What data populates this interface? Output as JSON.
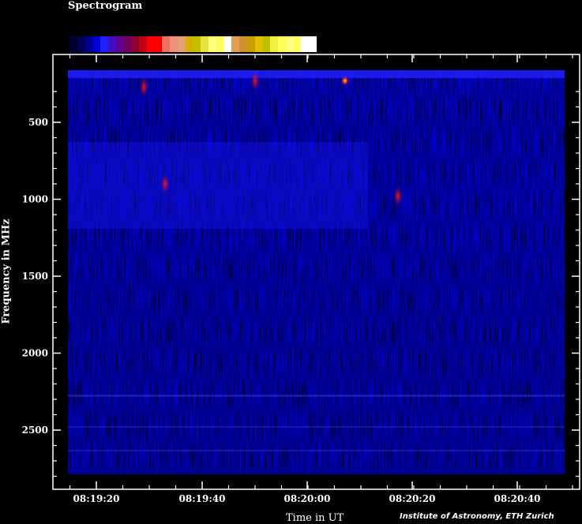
{
  "chart_data": {
    "type": "heatmap",
    "title": "Spectrogram",
    "xlabel": "Time in UT",
    "ylabel": "Frequency in MHz",
    "x_ticks": [
      "08:19:20",
      "08:19:40",
      "08:20:00",
      "08:20:20",
      "08:20:40"
    ],
    "y_ticks": [
      "500",
      "1000",
      "1500",
      "2000",
      "2500"
    ],
    "y_tick_values": [
      500,
      1000,
      1500,
      2000,
      2500
    ],
    "ylim": [
      190,
      2810
    ],
    "y_inverted": true,
    "credit": "Institute of Astronomy, ETH Zurich",
    "colorbar": [
      "#000030",
      "#00005a",
      "#000090",
      "#0000d0",
      "#2020ff",
      "#4010c0",
      "#600090",
      "#700060",
      "#900030",
      "#c00010",
      "#ff0000",
      "#ff0000",
      "#f07060",
      "#f09080",
      "#e8a070",
      "#d8b000",
      "#c0c000",
      "#e8e040",
      "#ffff80",
      "#ffff60",
      "#ffffff",
      "#e0a050",
      "#d09030",
      "#c8a000",
      "#e0c000",
      "#c0c000",
      "#f0f040",
      "#ffff60",
      "#ffff80",
      "#ffff60",
      "#ffffff",
      "#ffffff"
    ],
    "hotspots": [
      {
        "time": "08:19:29",
        "freq": 270,
        "intensity": "red"
      },
      {
        "time": "08:19:50",
        "freq": 230,
        "intensity": "red"
      },
      {
        "time": "08:20:07",
        "freq": 230,
        "intensity": "yellow"
      },
      {
        "time": "08:19:33",
        "freq": 900,
        "intensity": "red"
      },
      {
        "time": "08:20:17",
        "freq": 980,
        "intensity": "red"
      }
    ]
  }
}
